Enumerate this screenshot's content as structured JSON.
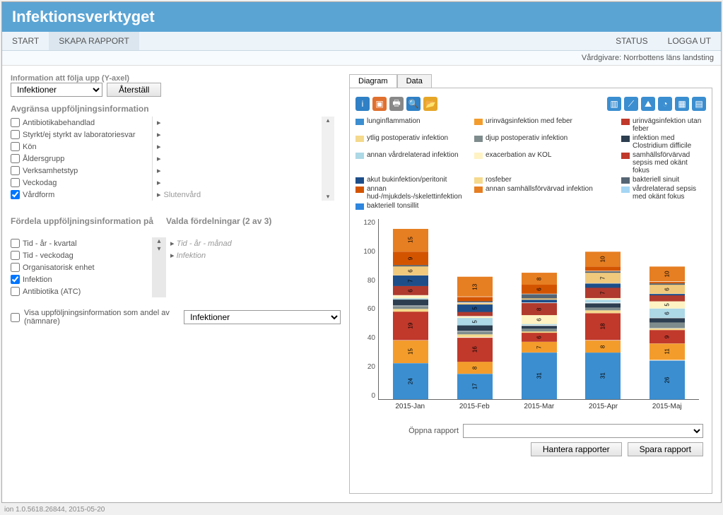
{
  "header": {
    "title": "Infektionsverktyget"
  },
  "menubar": {
    "start": "START",
    "skapa": "SKAPA RAPPORT",
    "status": "STATUS",
    "logout": "LOGGA UT"
  },
  "subbar": {
    "vardgivare": "Vårdgivare: Norrbottens läns landsting"
  },
  "left": {
    "yaxis_label": "Information att följa upp (Y-axel)",
    "yaxis_select": "Infektioner",
    "reset_btn": "Återställ",
    "filter_title": "Avgränsa uppföljningsinformation",
    "filters": [
      {
        "label": "Antibiotikabehandlad",
        "checked": false,
        "flyout": ""
      },
      {
        "label": "Styrkt/ej styrkt av laboratoriesvar",
        "checked": false,
        "flyout": ""
      },
      {
        "label": "Kön",
        "checked": false,
        "flyout": ""
      },
      {
        "label": "Åldersgrupp",
        "checked": false,
        "flyout": ""
      },
      {
        "label": "Verksamhetstyp",
        "checked": false,
        "flyout": ""
      },
      {
        "label": "Veckodag",
        "checked": false,
        "flyout": ""
      },
      {
        "label": "Vårdform",
        "checked": true,
        "flyout": "Slutenvård"
      }
    ],
    "distrib_title": "Fördela uppföljningsinformation på",
    "distrib_selected_title": "Valda fördelningar (2 av 3)",
    "distrib_opts": [
      {
        "label": "Tid - år - kvartal",
        "checked": false
      },
      {
        "label": "Tid - veckodag",
        "checked": false
      },
      {
        "label": "Organisatorisk enhet",
        "checked": false
      },
      {
        "label": "Infektion",
        "checked": true
      },
      {
        "label": "Antibiotika (ATC)",
        "checked": false
      }
    ],
    "distrib_selected": [
      "Tid - år - månad",
      "Infektion"
    ],
    "andel_label": "Visa uppföljningsinformation som andel av (nämnare)",
    "andel_select": "Infektioner"
  },
  "tabs": {
    "diagram": "Diagram",
    "data": "Data"
  },
  "legend": [
    {
      "label": "lunginflammation",
      "color": "#3b8ed0"
    },
    {
      "label": "urinvägsinfektion med feber",
      "color": "#f39c2c"
    },
    {
      "label": "urinvägsinfektion utan feber",
      "color": "#c0392b"
    },
    {
      "label": "ytlig postoperativ infektion",
      "color": "#f5d98c"
    },
    {
      "label": "djup postoperativ infektion",
      "color": "#7f8c8d"
    },
    {
      "label": "infektion med Clostridium difficile",
      "color": "#2c3e50"
    },
    {
      "label": "annan vårdrelaterad infektion",
      "color": "#add8e6"
    },
    {
      "label": "exacerbation av KOL",
      "color": "#fff3c4"
    },
    {
      "label": "samhällsförvärvad sepsis med okänt fokus",
      "color": "#c0392b"
    },
    {
      "label": "akut bukinfektion/peritonit",
      "color": "#1d4e89"
    },
    {
      "label": "rosfeber",
      "color": "#f5d98c"
    },
    {
      "label": "bakteriell sinuit",
      "color": "#566573"
    },
    {
      "label": "annan hud-/mjukdels-/skelettinfektion",
      "color": "#d35400"
    },
    {
      "label": "annan samhällsförvärvad infektion",
      "color": "#e67e22"
    },
    {
      "label": "vårdrelaterad sepsis med okänt fokus",
      "color": "#a5d6f3"
    },
    {
      "label": "bakteriell tonsillit",
      "color": "#2e86de"
    }
  ],
  "chart_data": {
    "type": "bar",
    "ylim": [
      0,
      120
    ],
    "yticks": [
      0,
      20,
      40,
      60,
      80,
      100,
      120
    ],
    "categories": [
      "2015-Jan",
      "2015-Feb",
      "2015-Mar",
      "2015-Apr",
      "2015-Maj"
    ],
    "series": [
      {
        "name": "lunginflammation",
        "color": "#3b8ed0",
        "values": [
          24,
          17,
          31,
          31,
          26
        ]
      },
      {
        "name": "urinvägsinfektion med feber",
        "color": "#f39c2c",
        "values": [
          15,
          8,
          7,
          8,
          11
        ]
      },
      {
        "name": "urinvägsinfektion utan feber",
        "color": "#c0392b",
        "values": [
          19,
          16,
          6,
          18,
          9
        ]
      },
      {
        "name": "ytlig postoperativ infektion",
        "color": "#f5d98c",
        "values": [
          2,
          2,
          1,
          2,
          1
        ]
      },
      {
        "name": "djup postoperativ infektion",
        "color": "#7f8c8d",
        "values": [
          2,
          2,
          2,
          2,
          4
        ]
      },
      {
        "name": "infektion med Clostridium difficile",
        "color": "#2c3e50",
        "values": [
          4,
          4,
          2,
          3,
          3
        ]
      },
      {
        "name": "annan vårdrelaterad infektion",
        "color": "#add8e6",
        "values": [
          1,
          5,
          1,
          2,
          6
        ]
      },
      {
        "name": "exacerbation av KOL",
        "color": "#fff3c4",
        "values": [
          2,
          1,
          6,
          1,
          5
        ]
      },
      {
        "name": "samhällsförvärvad sepsis med okänt fokus",
        "color": "#b03a2e",
        "values": [
          6,
          3,
          8,
          7,
          4
        ]
      },
      {
        "name": "akut bukinfektion/peritonit",
        "color": "#1d4e89",
        "values": [
          7,
          5,
          2,
          3,
          1
        ]
      },
      {
        "name": "rosfeber",
        "color": "#f0c97d",
        "values": [
          6,
          1,
          1,
          7,
          6
        ]
      },
      {
        "name": "bakteriell sinuit",
        "color": "#566573",
        "values": [
          1,
          1,
          3,
          1,
          1
        ]
      },
      {
        "name": "annan hud-/mjukdels-/skelettinfektion",
        "color": "#d35400",
        "values": [
          9,
          3,
          6,
          3,
          1
        ]
      },
      {
        "name": "annan samhällsförvärvad infektion",
        "color": "#e67e22",
        "values": [
          15,
          13,
          8,
          10,
          10
        ]
      }
    ]
  },
  "bottom": {
    "oppna_label": "Öppna rapport",
    "hantera_btn": "Hantera rapporter",
    "spara_btn": "Spara rapport"
  },
  "footer": {
    "version": "ion 1.0.5618.26844, 2015-05-20"
  }
}
